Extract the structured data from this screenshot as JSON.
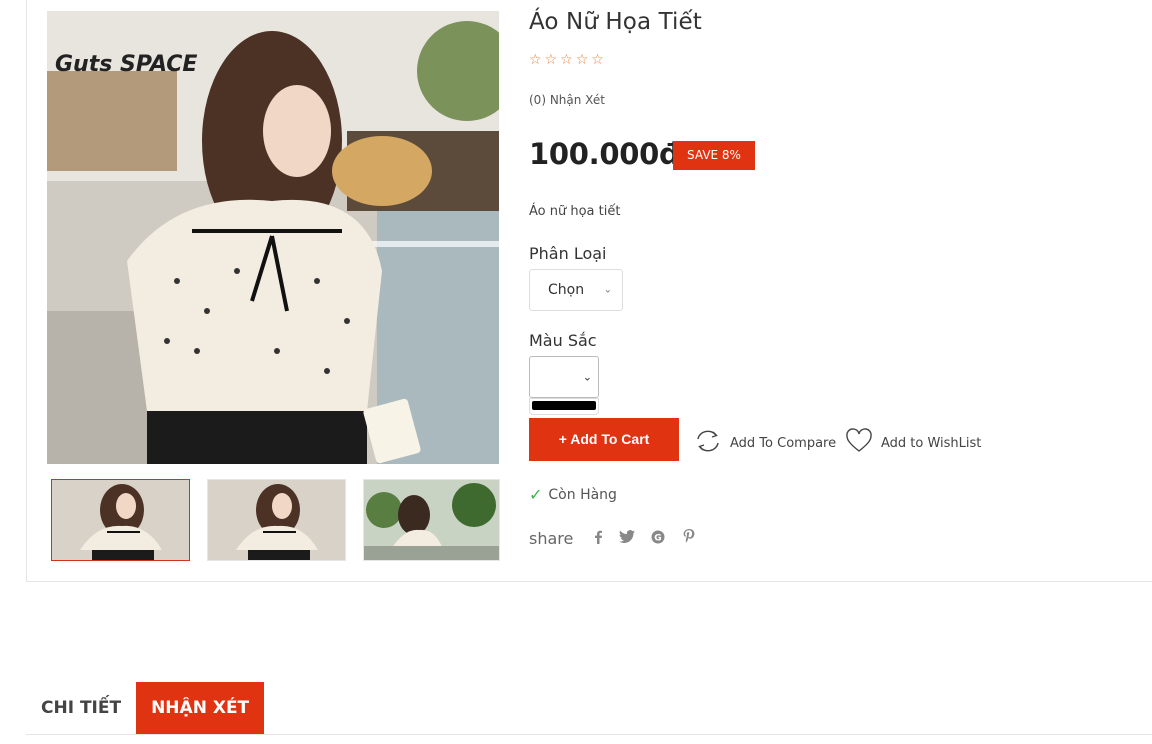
{
  "product": {
    "title": "Áo Nữ Họa Tiết",
    "reviews_text": "(0) Nhận Xét",
    "price": "100.000đ",
    "save_badge": "SAVE 8%",
    "short_description": "Áo nữ họa tiết",
    "rating": 0,
    "rating_max": 5,
    "stars": [
      "☆",
      "☆",
      "☆",
      "☆",
      "☆"
    ]
  },
  "options": {
    "type_label": "Phân Loại",
    "type_selected": "Chọn",
    "color_label": "Màu Sắc",
    "color_selected": "",
    "color_swatch": "#000000"
  },
  "actions": {
    "add_to_cart": "+ Add To Cart",
    "compare": "Add To Compare",
    "wishlist": "Add to WishList"
  },
  "stock": "Còn Hàng",
  "share": {
    "label": "share",
    "icons": [
      "facebook-icon",
      "twitter-icon",
      "google-plus-icon",
      "pinterest-icon"
    ]
  },
  "tabs": [
    {
      "label": "CHI TIẾT",
      "active": false
    },
    {
      "label": "NHẬN XÉT",
      "active": true
    }
  ],
  "colors": {
    "accent": "#e03312",
    "star": "#e8813b",
    "stock_check": "#3bb44a"
  }
}
